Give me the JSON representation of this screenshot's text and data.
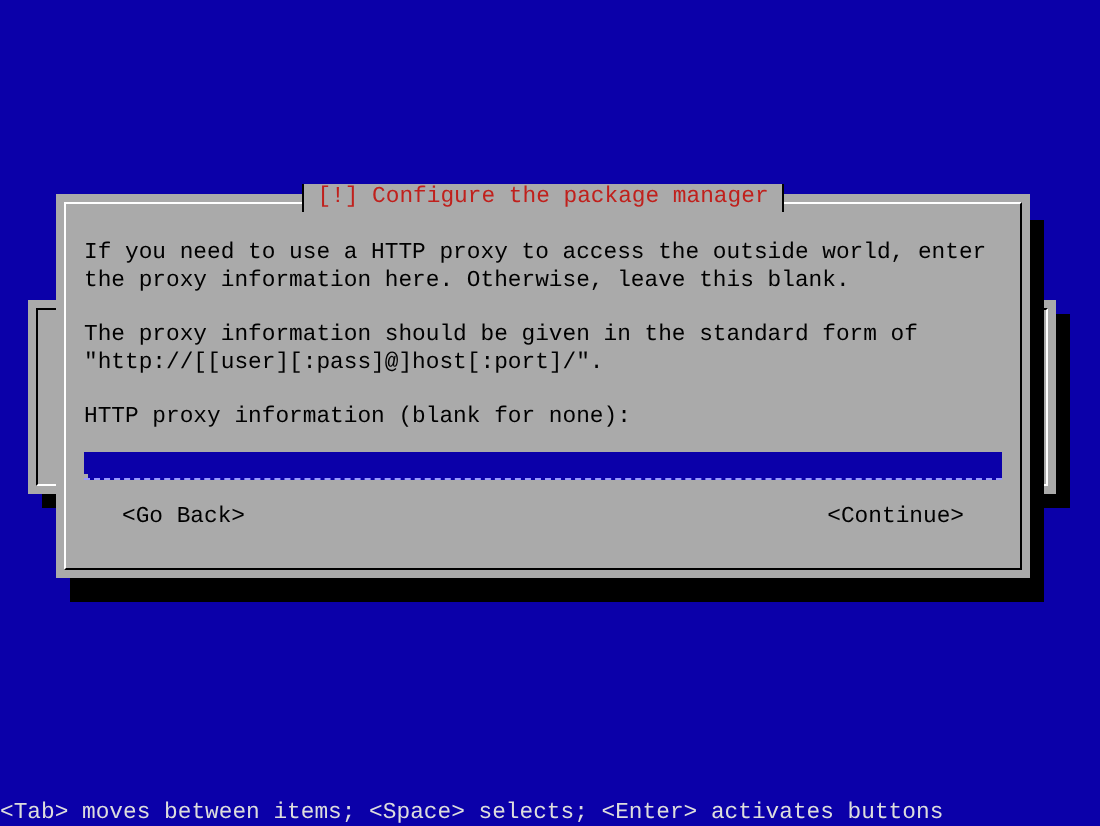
{
  "dialog": {
    "title": "[!] Configure the package manager",
    "paragraphs": [
      "If you need to use a HTTP proxy to access the outside world, enter\nthe proxy information here. Otherwise, leave this blank.",
      "The proxy information should be given in the standard form of\n\"http://[[user][:pass]@]host[:port]/\"."
    ],
    "field": {
      "label": "HTTP proxy information (blank for none):"
    },
    "buttons": [
      {
        "label": "<Go Back>"
      },
      {
        "label": "<Continue>"
      }
    ]
  },
  "status_bar": "<Tab> moves between items; <Space> selects; <Enter> activates buttons"
}
